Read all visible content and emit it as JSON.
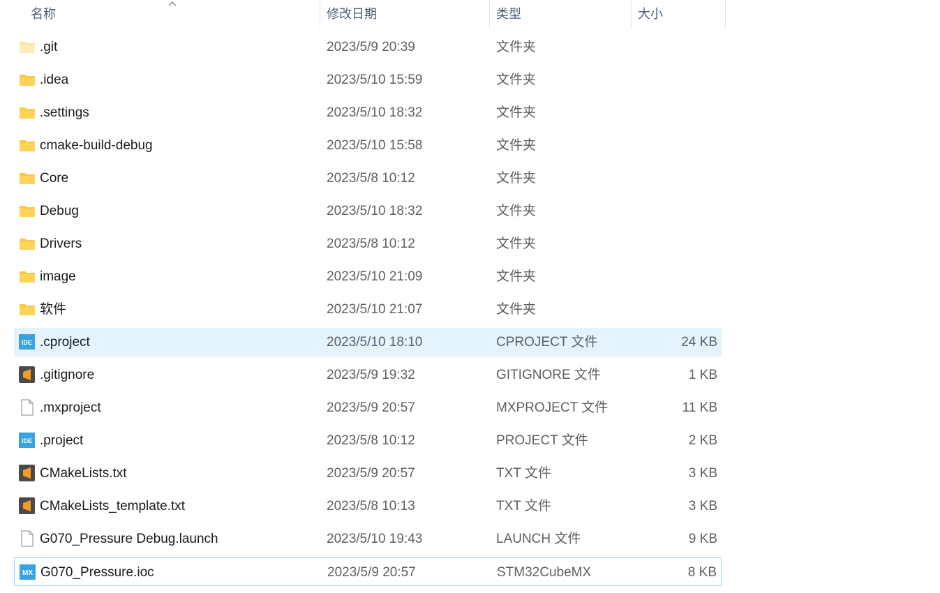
{
  "columns": {
    "name": "名称",
    "date": "修改日期",
    "type": "类型",
    "size": "大小"
  },
  "rows": [
    {
      "name": ".git",
      "date": "2023/5/9 20:39",
      "type": "文件夹",
      "size": "",
      "icon": "folder-light-icon"
    },
    {
      "name": ".idea",
      "date": "2023/5/10 15:59",
      "type": "文件夹",
      "size": "",
      "icon": "folder-icon"
    },
    {
      "name": ".settings",
      "date": "2023/5/10 18:32",
      "type": "文件夹",
      "size": "",
      "icon": "folder-icon"
    },
    {
      "name": "cmake-build-debug",
      "date": "2023/5/10 15:58",
      "type": "文件夹",
      "size": "",
      "icon": "folder-icon"
    },
    {
      "name": "Core",
      "date": "2023/5/8 10:12",
      "type": "文件夹",
      "size": "",
      "icon": "folder-icon"
    },
    {
      "name": "Debug",
      "date": "2023/5/10 18:32",
      "type": "文件夹",
      "size": "",
      "icon": "folder-icon"
    },
    {
      "name": "Drivers",
      "date": "2023/5/8 10:12",
      "type": "文件夹",
      "size": "",
      "icon": "folder-icon"
    },
    {
      "name": "image",
      "date": "2023/5/10 21:09",
      "type": "文件夹",
      "size": "",
      "icon": "folder-icon"
    },
    {
      "name": "软件",
      "date": "2023/5/10 21:07",
      "type": "文件夹",
      "size": "",
      "icon": "folder-icon"
    },
    {
      "name": ".cproject",
      "date": "2023/5/10 18:10",
      "type": "CPROJECT 文件",
      "size": "24 KB",
      "icon": "ide-file-icon"
    },
    {
      "name": ".gitignore",
      "date": "2023/5/9 19:32",
      "type": "GITIGNORE 文件",
      "size": "1 KB",
      "icon": "sublime-file-icon"
    },
    {
      "name": ".mxproject",
      "date": "2023/5/9 20:57",
      "type": "MXPROJECT 文件",
      "size": "11 KB",
      "icon": "blank-file-icon"
    },
    {
      "name": ".project",
      "date": "2023/5/8 10:12",
      "type": "PROJECT 文件",
      "size": "2 KB",
      "icon": "ide-file-icon"
    },
    {
      "name": "CMakeLists.txt",
      "date": "2023/5/9 20:57",
      "type": "TXT 文件",
      "size": "3 KB",
      "icon": "sublime-file-icon"
    },
    {
      "name": "CMakeLists_template.txt",
      "date": "2023/5/8 10:13",
      "type": "TXT 文件",
      "size": "3 KB",
      "icon": "sublime-file-icon"
    },
    {
      "name": "G070_Pressure Debug.launch",
      "date": "2023/5/10 19:43",
      "type": "LAUNCH 文件",
      "size": "9 KB",
      "icon": "blank-file-icon"
    },
    {
      "name": "G070_Pressure.ioc",
      "date": "2023/5/9 20:57",
      "type": "STM32CubeMX",
      "size": "8 KB",
      "icon": "mx-file-icon"
    }
  ],
  "icon_labels": {
    "ide": "IDE",
    "mx": "MX"
  },
  "colors": {
    "folder": "#f8c843",
    "folder_light": "#fbe39a",
    "ide_blue": "#3aa2e0",
    "sublime_bg": "#4a4a4a",
    "sublime_s": "#f59a23",
    "hover": "#e5f3ff",
    "focus_border": "#99d1ff"
  }
}
